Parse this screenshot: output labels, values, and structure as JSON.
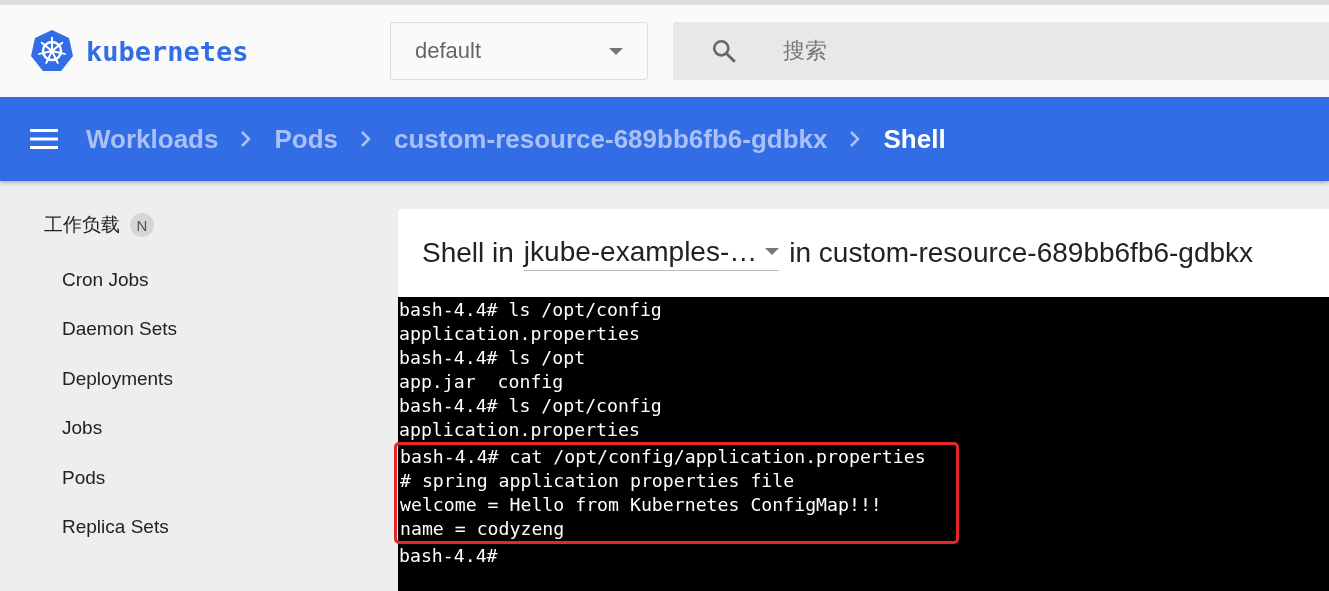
{
  "header": {
    "logo_text": "kubernetes",
    "namespace": {
      "value": "default"
    },
    "search": {
      "placeholder": "搜索"
    }
  },
  "breadcrumbs": [
    {
      "label": "Workloads",
      "current": false
    },
    {
      "label": "Pods",
      "current": false
    },
    {
      "label": "custom-resource-689bb6fb6-gdbkx",
      "current": false
    },
    {
      "label": "Shell",
      "current": true
    }
  ],
  "sidebar": {
    "section": {
      "label": "工作负载",
      "badge": "N"
    },
    "items": [
      "Cron Jobs",
      "Daemon Sets",
      "Deployments",
      "Jobs",
      "Pods",
      "Replica Sets"
    ]
  },
  "shell": {
    "prefix": "Shell in",
    "container": "jkube-examples-…",
    "suffix": "in custom-resource-689bb6fb6-gdbkx",
    "lines": [
      {
        "text": "bash-4.4# ls /opt/config",
        "highlighted": false
      },
      {
        "text": "application.properties",
        "highlighted": false
      },
      {
        "text": "bash-4.4# ls /opt",
        "highlighted": false
      },
      {
        "text": "app.jar  config",
        "highlighted": false
      },
      {
        "text": "bash-4.4# ls /opt/config",
        "highlighted": false
      },
      {
        "text": "application.properties",
        "highlighted": false
      },
      {
        "text": "bash-4.4# cat /opt/config/application.properties",
        "highlighted": true
      },
      {
        "text": "# spring application properties file",
        "highlighted": true
      },
      {
        "text": "welcome = Hello from Kubernetes ConfigMap!!!",
        "highlighted": true
      },
      {
        "text": "name = codyzeng",
        "highlighted": true
      },
      {
        "text": "bash-4.4#",
        "highlighted": false
      }
    ]
  }
}
